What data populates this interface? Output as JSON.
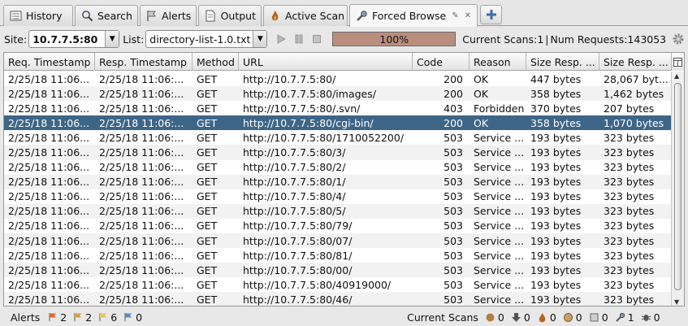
{
  "tabs": [
    {
      "label": "History",
      "icon": "history-icon"
    },
    {
      "label": "Search",
      "icon": "search-icon"
    },
    {
      "label": "Alerts",
      "icon": "flag-icon"
    },
    {
      "label": "Output",
      "icon": "document-icon"
    },
    {
      "label": "Active Scan",
      "icon": "flame-icon"
    },
    {
      "label": "Forced Browse",
      "icon": "wrench-icon",
      "active": true
    }
  ],
  "toolbar": {
    "site_label": "Site:",
    "site_value": "10.7.7.5:80",
    "list_label": "List:",
    "list_value": "directory-list-1.0.txt",
    "progress_text": "100%",
    "progress_value": 100,
    "current_scans": "Current Scans:1",
    "separator": "|",
    "num_requests": "Num Requests:143053"
  },
  "table": {
    "columns": [
      "Req. Timestamp",
      "Resp. Timestamp",
      "Method",
      "URL",
      "Code",
      "Reason",
      "Size Resp. ...",
      "Size Resp. ..."
    ],
    "selected_row": 3,
    "rows": [
      [
        "2/25/18 11:06...",
        "2/25/18 11:06:...",
        "GET",
        "http://10.7.7.5:80/",
        "200",
        "OK",
        "447 bytes",
        "28,067 byt..."
      ],
      [
        "2/25/18 11:06...",
        "2/25/18 11:06:...",
        "GET",
        "http://10.7.7.5:80/images/",
        "200",
        "OK",
        "358 bytes",
        "1,462 bytes"
      ],
      [
        "2/25/18 11:06...",
        "2/25/18 11:06:...",
        "GET",
        "http://10.7.7.5:80/.svn/",
        "403",
        "Forbidden",
        "370 bytes",
        "207 bytes"
      ],
      [
        "2/25/18 11:06...",
        "2/25/18 11:06:...",
        "GET",
        "http://10.7.7.5:80/cgi-bin/",
        "200",
        "OK",
        "358 bytes",
        "1,070 bytes"
      ],
      [
        "2/25/18 11:06...",
        "2/25/18 11:06:...",
        "GET",
        "http://10.7.7.5:80/1710052200/",
        "503",
        "Service ...",
        "193 bytes",
        "323 bytes"
      ],
      [
        "2/25/18 11:06...",
        "2/25/18 11:06:...",
        "GET",
        "http://10.7.7.5:80/3/",
        "503",
        "Service ...",
        "193 bytes",
        "323 bytes"
      ],
      [
        "2/25/18 11:06...",
        "2/25/18 11:06:...",
        "GET",
        "http://10.7.7.5:80/2/",
        "503",
        "Service ...",
        "193 bytes",
        "323 bytes"
      ],
      [
        "2/25/18 11:06...",
        "2/25/18 11:06:...",
        "GET",
        "http://10.7.7.5:80/1/",
        "503",
        "Service ...",
        "193 bytes",
        "323 bytes"
      ],
      [
        "2/25/18 11:06...",
        "2/25/18 11:06:...",
        "GET",
        "http://10.7.7.5:80/4/",
        "503",
        "Service ...",
        "193 bytes",
        "323 bytes"
      ],
      [
        "2/25/18 11:06...",
        "2/25/18 11:06:...",
        "GET",
        "http://10.7.7.5:80/5/",
        "503",
        "Service ...",
        "193 bytes",
        "323 bytes"
      ],
      [
        "2/25/18 11:06...",
        "2/25/18 11:06:...",
        "GET",
        "http://10.7.7.5:80/79/",
        "503",
        "Service ...",
        "193 bytes",
        "323 bytes"
      ],
      [
        "2/25/18 11:06...",
        "2/25/18 11:06:...",
        "GET",
        "http://10.7.7.5:80/07/",
        "503",
        "Service ...",
        "193 bytes",
        "323 bytes"
      ],
      [
        "2/25/18 11:06...",
        "2/25/18 11:06:...",
        "GET",
        "http://10.7.7.5:80/81/",
        "503",
        "Service ...",
        "193 bytes",
        "323 bytes"
      ],
      [
        "2/25/18 11:06...",
        "2/25/18 11:06:...",
        "GET",
        "http://10.7.7.5:80/00/",
        "503",
        "Service ...",
        "193 bytes",
        "323 bytes"
      ],
      [
        "2/25/18 11:06...",
        "2/25/18 11:06:...",
        "GET",
        "http://10.7.7.5:80/40919000/",
        "503",
        "Service ...",
        "193 bytes",
        "323 bytes"
      ],
      [
        "2/25/18 11:06...",
        "2/25/18 11:06:...",
        "GET",
        "http://10.7.7.5:80/46/",
        "503",
        "Service ...",
        "193 bytes",
        "323 bytes"
      ]
    ]
  },
  "status": {
    "alerts_label": "Alerts",
    "high_alerts": "2",
    "medium_alerts": "2",
    "low_alerts": "6",
    "info_alerts": "0",
    "current_scans_label": "Current Scans",
    "scan_counts": [
      "0",
      "0",
      "0",
      "0",
      "0",
      "1",
      "0"
    ]
  },
  "colors": {
    "selected_row": "#3d6587",
    "progress_fill": "#b98e7e",
    "high_flag": "#d66a3a",
    "medium_flag": "#d7a23a",
    "low_flag": "#e1c96a",
    "info_flag": "#5a89c6"
  }
}
